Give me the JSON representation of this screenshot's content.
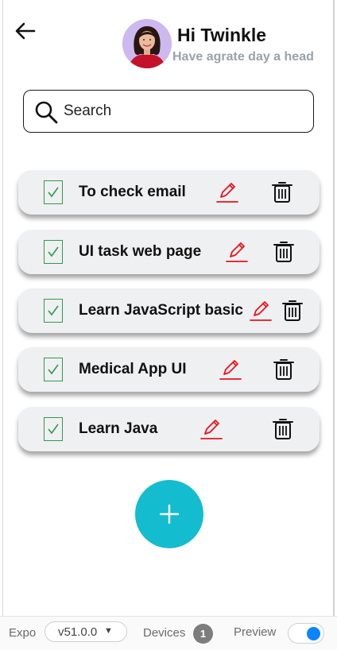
{
  "header": {
    "greeting": "Hi Twinkle",
    "subtitle": "Have agrate day a head"
  },
  "search": {
    "placeholder": "Search",
    "value": ""
  },
  "tasks": [
    {
      "label": "To check email",
      "done": true
    },
    {
      "label": "UI task web page",
      "done": true
    },
    {
      "label": "Learn JavaScript basic",
      "done": true
    },
    {
      "label": "Medical App UI",
      "done": true
    },
    {
      "label": "Learn Java",
      "done": true
    }
  ],
  "colors": {
    "accent": "#14bcd0",
    "edit_icon": "#e8141c",
    "check": "#2e9b4e",
    "task_card": "#eff0f2",
    "subtitle": "#9aa1ab"
  },
  "icons": {
    "back": "arrow-left-icon",
    "search": "search-icon",
    "check": "checkbox-checked-icon",
    "edit": "pencil-icon",
    "delete": "trash-icon",
    "add": "plus-icon"
  },
  "bottom_bar": {
    "expo_label": "Expo",
    "version": "v51.0.0",
    "devices_label": "Devices",
    "devices_count": "1",
    "preview_label": "Preview",
    "preview_enabled": true
  }
}
